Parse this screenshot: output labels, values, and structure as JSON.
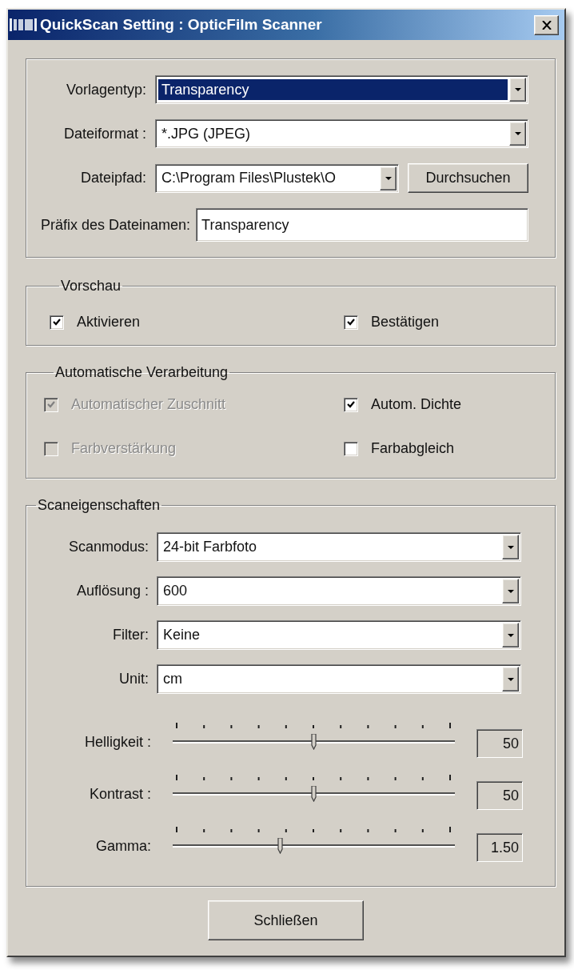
{
  "window": {
    "title": "QuickScan Setting : OpticFilm Scanner"
  },
  "file_settings": {
    "fields": [
      {
        "label": "Vorlagentyp:",
        "kind": "dropdown",
        "value": "Transparency",
        "focused": true
      },
      {
        "label": "Dateiformat :",
        "kind": "dropdown",
        "value": "*.JPG (JPEG)",
        "focused": false
      },
      {
        "label": "Dateipfad:",
        "kind": "path",
        "value": "C:\\Program Files\\Plustek\\O",
        "focused": false,
        "button": "Durchsuchen"
      },
      {
        "label": "Präfix des Dateinamen:",
        "kind": "text",
        "value": "Transparency",
        "focused": false
      }
    ]
  },
  "preview": {
    "legend": "Vorschau",
    "options": [
      {
        "label": "Aktivieren",
        "checked": true,
        "disabled": false
      },
      {
        "label": "Bestätigen",
        "checked": true,
        "disabled": false
      }
    ]
  },
  "auto_processing": {
    "legend": "Automatische Verarbeitung",
    "options": [
      {
        "label": "Automatischer Zuschnitt",
        "checked": true,
        "disabled": true
      },
      {
        "label": "Autom. Dichte",
        "checked": true,
        "disabled": false
      },
      {
        "label": "Farbverstärkung",
        "checked": false,
        "disabled": true
      },
      {
        "label": "Farbabgleich",
        "checked": false,
        "disabled": false
      }
    ]
  },
  "scan_properties": {
    "legend": "Scaneigenschaften",
    "dropdowns": [
      {
        "label": "Scanmodus:",
        "value": "24-bit Farbfoto"
      },
      {
        "label": "Auflösung :",
        "value": "600"
      },
      {
        "label": "Filter:",
        "value": "Keine"
      },
      {
        "label": "Unit:",
        "value": "cm"
      }
    ],
    "sliders": [
      {
        "label": "Helligkeit :",
        "level": 0.5,
        "reading": "50"
      },
      {
        "label": "Kontrast :",
        "level": 0.5,
        "reading": "50"
      },
      {
        "label": "Gamma:",
        "level": 0.38,
        "reading": "1.50"
      }
    ]
  },
  "buttons": [
    "Schließen"
  ]
}
